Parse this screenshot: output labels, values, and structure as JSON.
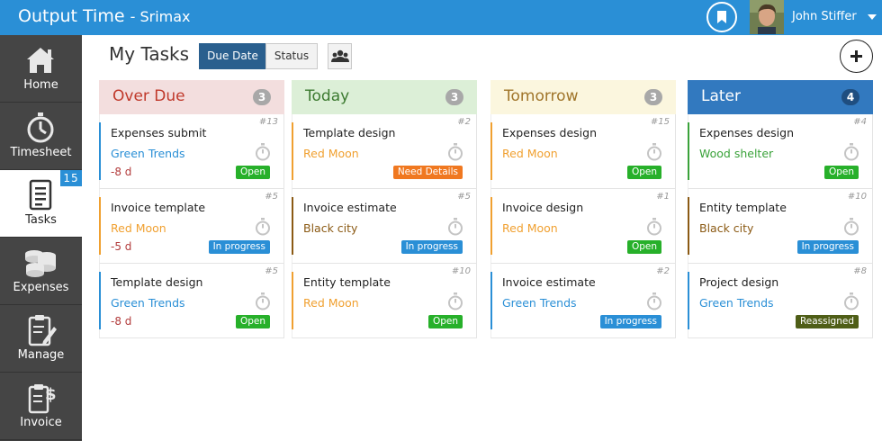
{
  "header": {
    "app_title": "Output Time",
    "app_subtitle": "- Srimax",
    "user_name": "John Stiffer",
    "icons": {
      "bookmark": "bookmark-icon",
      "avatar": "user-photo",
      "caret": "chevron-down-icon"
    }
  },
  "sidebar": {
    "items": [
      {
        "label": "Home",
        "icon": "home-icon",
        "active": false
      },
      {
        "label": "Timesheet",
        "icon": "stopwatch-icon",
        "active": false
      },
      {
        "label": "Tasks",
        "icon": "tasks-icon",
        "active": true,
        "badge": "15"
      },
      {
        "label": "Expenses",
        "icon": "coins-icon",
        "active": false
      },
      {
        "label": "Manage",
        "icon": "clipboard-edit-icon",
        "active": false
      },
      {
        "label": "Invoice",
        "icon": "invoice-icon",
        "active": false
      }
    ]
  },
  "toolbar": {
    "page_title": "My Tasks",
    "sort_due_date": "Due Date",
    "sort_status": "Status",
    "active_sort": "Due Date",
    "team_icon": "team-icon",
    "add_icon": "plus-icon"
  },
  "colors": {
    "header_bg": "#2a8fd6",
    "green_trends": "#2a8fd6",
    "red_moon": "#f0a030",
    "black_city": "#8b5a14",
    "wood_shelter": "#3aa23a",
    "open": "#27b02a",
    "in_progress": "#2a8fd6",
    "need_details": "#f07820",
    "reassigned": "#4f5e17"
  },
  "columns": [
    {
      "title": "Over Due",
      "count": "3",
      "head_bg": "#f3dede",
      "title_color": "#c0392b",
      "count_bg": "#a8a8a8",
      "cards": [
        {
          "id": "#13",
          "title": "Expenses submit",
          "client": "Green Trends",
          "client_color": "#2a8fd6",
          "days": "-8 d",
          "status": "Open",
          "status_color": "#27b02a"
        },
        {
          "id": "#5",
          "title": "Invoice template",
          "client": "Red Moon",
          "client_color": "#f0a030",
          "days": "-5 d",
          "status": "In progress",
          "status_color": "#2a8fd6"
        },
        {
          "id": "#5",
          "title": "Template design",
          "client": "Green Trends",
          "client_color": "#2a8fd6",
          "days": "-8 d",
          "status": "Open",
          "status_color": "#27b02a"
        }
      ]
    },
    {
      "title": "Today",
      "count": "3",
      "head_bg": "#dcefd7",
      "title_color": "#3c7a30",
      "count_bg": "#a8a8a8",
      "cards": [
        {
          "id": "#2",
          "title": "Template design",
          "client": "Red Moon",
          "client_color": "#f0a030",
          "status": "Need Details",
          "status_color": "#f07820"
        },
        {
          "id": "#5",
          "title": "Invoice estimate",
          "client": "Black city",
          "client_color": "#8b5a14",
          "status": "In progress",
          "status_color": "#2a8fd6"
        },
        {
          "id": "#10",
          "title": "Entity template",
          "client": "Red Moon",
          "client_color": "#f0a030",
          "status": "Open",
          "status_color": "#27b02a"
        }
      ]
    },
    {
      "title": "Tomorrow",
      "count": "3",
      "head_bg": "#fbf6de",
      "title_color": "#a0752a",
      "count_bg": "#a8a8a8",
      "cards": [
        {
          "id": "#15",
          "title": "Expenses design",
          "client": "Red Moon",
          "client_color": "#f0a030",
          "status": "Open",
          "status_color": "#27b02a"
        },
        {
          "id": "#1",
          "title": "Invoice design",
          "client": "Red Moon",
          "client_color": "#f0a030",
          "status": "Open",
          "status_color": "#27b02a"
        },
        {
          "id": "#2",
          "title": "Invoice estimate",
          "client": "Green Trends",
          "client_color": "#2a8fd6",
          "status": "In progress",
          "status_color": "#2a8fd6"
        }
      ]
    },
    {
      "title": "Later",
      "count": "4",
      "head_bg": "#3279bf",
      "title_color": "#ffffff",
      "count_bg": "#1f4e80",
      "cards": [
        {
          "id": "#4",
          "title": "Expenses design",
          "client": "Wood shelter",
          "client_color": "#3aa23a",
          "status": "Open",
          "status_color": "#27b02a"
        },
        {
          "id": "#10",
          "title": "Entity template",
          "client": "Black city",
          "client_color": "#8b5a14",
          "status": "In progress",
          "status_color": "#2a8fd6"
        },
        {
          "id": "#8",
          "title": "Project design",
          "client": "Green Trends",
          "client_color": "#2a8fd6",
          "status": "Reassigned",
          "status_color": "#4f5e17"
        }
      ]
    }
  ]
}
